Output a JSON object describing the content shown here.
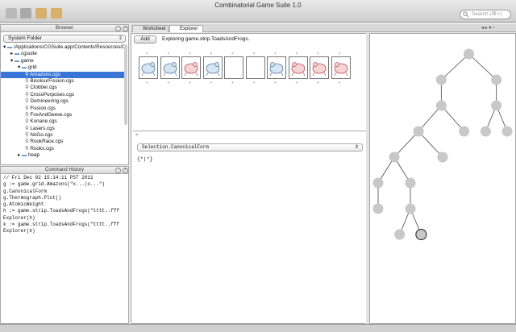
{
  "app": {
    "title": "Combinatorial Game Suite 1.0"
  },
  "search": {
    "placeholder": "Search (⌘+)"
  },
  "browser": {
    "title": "Browser",
    "folder": "System Folder",
    "tree": [
      {
        "label": "/Applications/CGSuite.app/Contents/Resources/CG",
        "depth": 0,
        "kind": "folder",
        "expanded": true
      },
      {
        "label": "cgsuite",
        "depth": 1,
        "kind": "folder",
        "expanded": false
      },
      {
        "label": "game",
        "depth": 1,
        "kind": "folder",
        "expanded": true
      },
      {
        "label": "grid",
        "depth": 2,
        "kind": "folder",
        "expanded": true
      },
      {
        "label": "Amazons.cgs",
        "depth": 3,
        "kind": "file",
        "selected": true
      },
      {
        "label": "BicolourFission.cgs",
        "depth": 3,
        "kind": "file"
      },
      {
        "label": "Clobber.cgs",
        "depth": 3,
        "kind": "file"
      },
      {
        "label": "CrossPurposes.cgs",
        "depth": 3,
        "kind": "file"
      },
      {
        "label": "Domineering.cgs",
        "depth": 3,
        "kind": "file"
      },
      {
        "label": "Fission.cgs",
        "depth": 3,
        "kind": "file"
      },
      {
        "label": "FoxAndGeese.cgs",
        "depth": 3,
        "kind": "file"
      },
      {
        "label": "Konane.cgs",
        "depth": 3,
        "kind": "file"
      },
      {
        "label": "Lasers.cgs",
        "depth": 3,
        "kind": "file"
      },
      {
        "label": "NoGo.cgs",
        "depth": 3,
        "kind": "file"
      },
      {
        "label": "RookRace.cgs",
        "depth": 3,
        "kind": "file"
      },
      {
        "label": "Rooks.cgs",
        "depth": 3,
        "kind": "file"
      },
      {
        "label": "heap",
        "depth": 2,
        "kind": "folder",
        "expanded": false
      }
    ]
  },
  "history": {
    "title": "Command History",
    "lines": [
      "// Fri Dec 02 15:14:11 PST 2011",
      "g := game.grid.Amazons(\"x...|o...\")",
      "g.CanonicalForm",
      "g.Thermograph.Plot()",
      "g.AtomicWeight",
      "h := game.strip.ToadsAndFrogs(\"tttt..fff",
      "Explorer(h)",
      "k := game.strip.ToadsAndFrogs(\"tttt..fff",
      "Explorer(k)"
    ]
  },
  "tabs": [
    {
      "label": "Worksheet",
      "active": false
    },
    {
      "label": "Explorer",
      "active": true
    }
  ],
  "explorer": {
    "add_label": "Add",
    "status": "Exploring game.strip.ToadsAndFrogs.",
    "cells": [
      "toad",
      "toad",
      "toad-red",
      "toad",
      "empty",
      "empty",
      "frog",
      "frog-red",
      "frog-red",
      "frog-red"
    ]
  },
  "worksheet": {
    "prompt": ">",
    "input": "Selection.CanonicalForm",
    "output": "{*|*}"
  },
  "gametree": {
    "nodes": [
      {
        "id": 0,
        "parent": null
      },
      {
        "id": 1,
        "parent": 0
      },
      {
        "id": 2,
        "parent": 0
      },
      {
        "id": 3,
        "parent": 1
      },
      {
        "id": 4,
        "parent": 2
      },
      {
        "id": 5,
        "parent": 3
      },
      {
        "id": 6,
        "parent": 3
      },
      {
        "id": 7,
        "parent": 4
      },
      {
        "id": 8,
        "parent": 4
      },
      {
        "id": 9,
        "parent": 5
      },
      {
        "id": 10,
        "parent": 5
      },
      {
        "id": 11,
        "parent": 9
      },
      {
        "id": 12,
        "parent": 9
      },
      {
        "id": 13,
        "parent": 11
      },
      {
        "id": 14,
        "parent": 12
      },
      {
        "id": 15,
        "parent": 14
      },
      {
        "id": 16,
        "parent": 14,
        "selected": true
      }
    ]
  },
  "colors": {
    "selection": "#3875d7",
    "node": "#c8c8c8",
    "toad": "#4a7aa8",
    "frog": "#c05050"
  }
}
